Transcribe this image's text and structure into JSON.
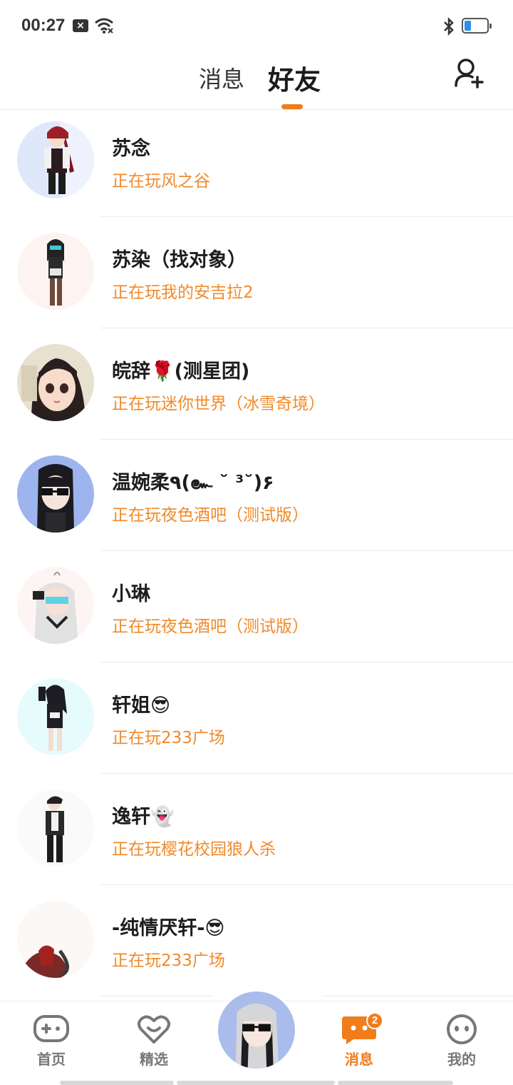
{
  "status_bar": {
    "time": "00:27",
    "notification_icon": "close-box-icon",
    "wifi_icon": "wifi-icon",
    "bluetooth_icon": "bluetooth-icon",
    "battery_level": 0.25,
    "battery_color": "#2c8ef0"
  },
  "header": {
    "tabs": [
      {
        "label": "消息",
        "active": false
      },
      {
        "label": "好友",
        "active": true
      }
    ],
    "accent_color": "#f07c1b",
    "add_friend_icon": "add-user-icon"
  },
  "friends": [
    {
      "name": "苏念",
      "status": "正在玩风之谷"
    },
    {
      "name": "苏染（找对象）",
      "status": "正在玩我的安吉拉2"
    },
    {
      "name": "皖辞🌹(测星团)",
      "status": "正在玩迷你世界（冰雪奇境）"
    },
    {
      "name": "温婉柔٩(๛ ˘ ³˘)۶",
      "status": "正在玩夜色酒吧（测试版）"
    },
    {
      "name": "小琳",
      "status": "正在玩夜色酒吧（测试版）"
    },
    {
      "name": "轩姐😎",
      "status": "正在玩233广场"
    },
    {
      "name": "逸轩👻",
      "status": "正在玩樱花校园狼人杀"
    },
    {
      "name": "-纯情厌轩-😎",
      "status": "正在玩233广场"
    }
  ],
  "bottom_nav": {
    "items": [
      {
        "label": "首页",
        "icon": "gamepad-icon",
        "active": false
      },
      {
        "label": "精选",
        "icon": "heart-icon",
        "active": false
      },
      {
        "label": "消息",
        "icon": "chat-bubble-icon",
        "active": true,
        "badge": "2"
      },
      {
        "label": "我的",
        "icon": "smiley-face-icon",
        "active": false
      }
    ],
    "active_color": "#f07c1b",
    "inactive_color": "#777777"
  }
}
